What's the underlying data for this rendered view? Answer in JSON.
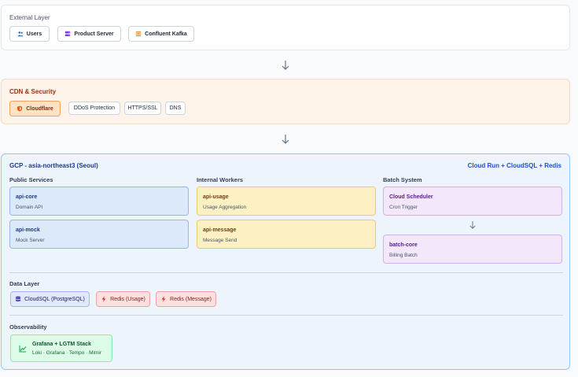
{
  "external": {
    "title": "External Layer",
    "chips": [
      {
        "label": "Users",
        "icon": "users-icon"
      },
      {
        "label": "Product Server",
        "icon": "server-icon"
      },
      {
        "label": "Confluent Kafka",
        "icon": "list-icon"
      }
    ]
  },
  "cdn": {
    "title": "CDN & Security",
    "chips": [
      {
        "label": "Cloudflare",
        "icon": "shield-icon"
      },
      {
        "label": "DDoS Protection"
      },
      {
        "label": "HTTPS/SSL"
      },
      {
        "label": "DNS"
      }
    ]
  },
  "gcp": {
    "title": "GCP - asia-northeast3 (Seoul)",
    "stack": "Cloud Run + CloudSQL + Redis",
    "columns": {
      "public": {
        "title": "Public Services",
        "cards": [
          {
            "title": "api-core",
            "subtitle": "Domain API"
          },
          {
            "title": "api-mock",
            "subtitle": "Mock Server"
          }
        ]
      },
      "workers": {
        "title": "Internal Workers",
        "cards": [
          {
            "title": "api-usage",
            "subtitle": "Usage Aggregation"
          },
          {
            "title": "api-message",
            "subtitle": "Message Send"
          }
        ]
      },
      "batch": {
        "title": "Batch System",
        "cards": [
          {
            "title": "Cloud Scheduler",
            "subtitle": "Cron Trigger"
          },
          {
            "title": "batch-core",
            "subtitle": "Billing Batch"
          }
        ]
      }
    },
    "data_layer": {
      "title": "Data Layer",
      "chips": [
        {
          "label": "CloudSQL (PostgreSQL)",
          "icon": "database-icon"
        },
        {
          "label": "Redis (Usage)",
          "icon": "bolt-icon"
        },
        {
          "label": "Redis (Message)",
          "icon": "bolt-icon"
        }
      ]
    },
    "observability": {
      "title": "Observability",
      "card": {
        "title": "Grafana + LGTM Stack",
        "subtitle": "Loki · Grafana · Tempo · Mimir",
        "icon": "chart-icon"
      }
    }
  },
  "colors": {
    "external_bg": "#ffffff",
    "cdn_bg": "#fdf3e8",
    "gcp_bg": "#eef4fc",
    "gcp_accent": "#1d4ed8",
    "public_card": "#dbe9fb",
    "worker_card": "#fdf1c4",
    "batch_card": "#f3e8fb",
    "sql_chip": "#e0e7ff",
    "redis_chip": "#fde0e0",
    "obs_card": "#dcfce7"
  }
}
